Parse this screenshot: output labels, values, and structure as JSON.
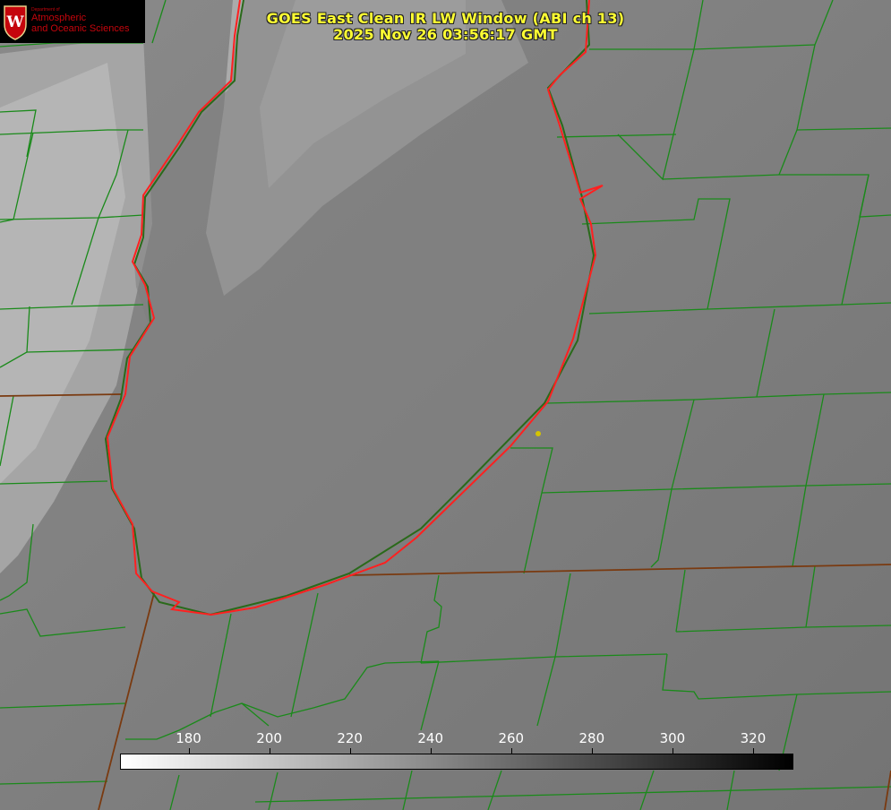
{
  "title": {
    "line1": "GOES East Clean IR LW Window (ABI ch 13)",
    "line2": "2025 Nov 26 03:56:17 GMT"
  },
  "logo": {
    "small_text": "Department of",
    "line1": "Atmospheric",
    "line2": "and Oceanic Sciences",
    "crest_letter": "W",
    "color": "#c5050c"
  },
  "colorbar": {
    "ticks": [
      "180",
      "200",
      "220",
      "240",
      "260",
      "280",
      "300",
      "320"
    ],
    "range": [
      163,
      330
    ],
    "colormap": "white-to-black"
  },
  "colors": {
    "title": "#ffff33",
    "county_borders": "#1a8a1a",
    "lake_outline": "#ff2020",
    "marker": "#d4c400"
  }
}
